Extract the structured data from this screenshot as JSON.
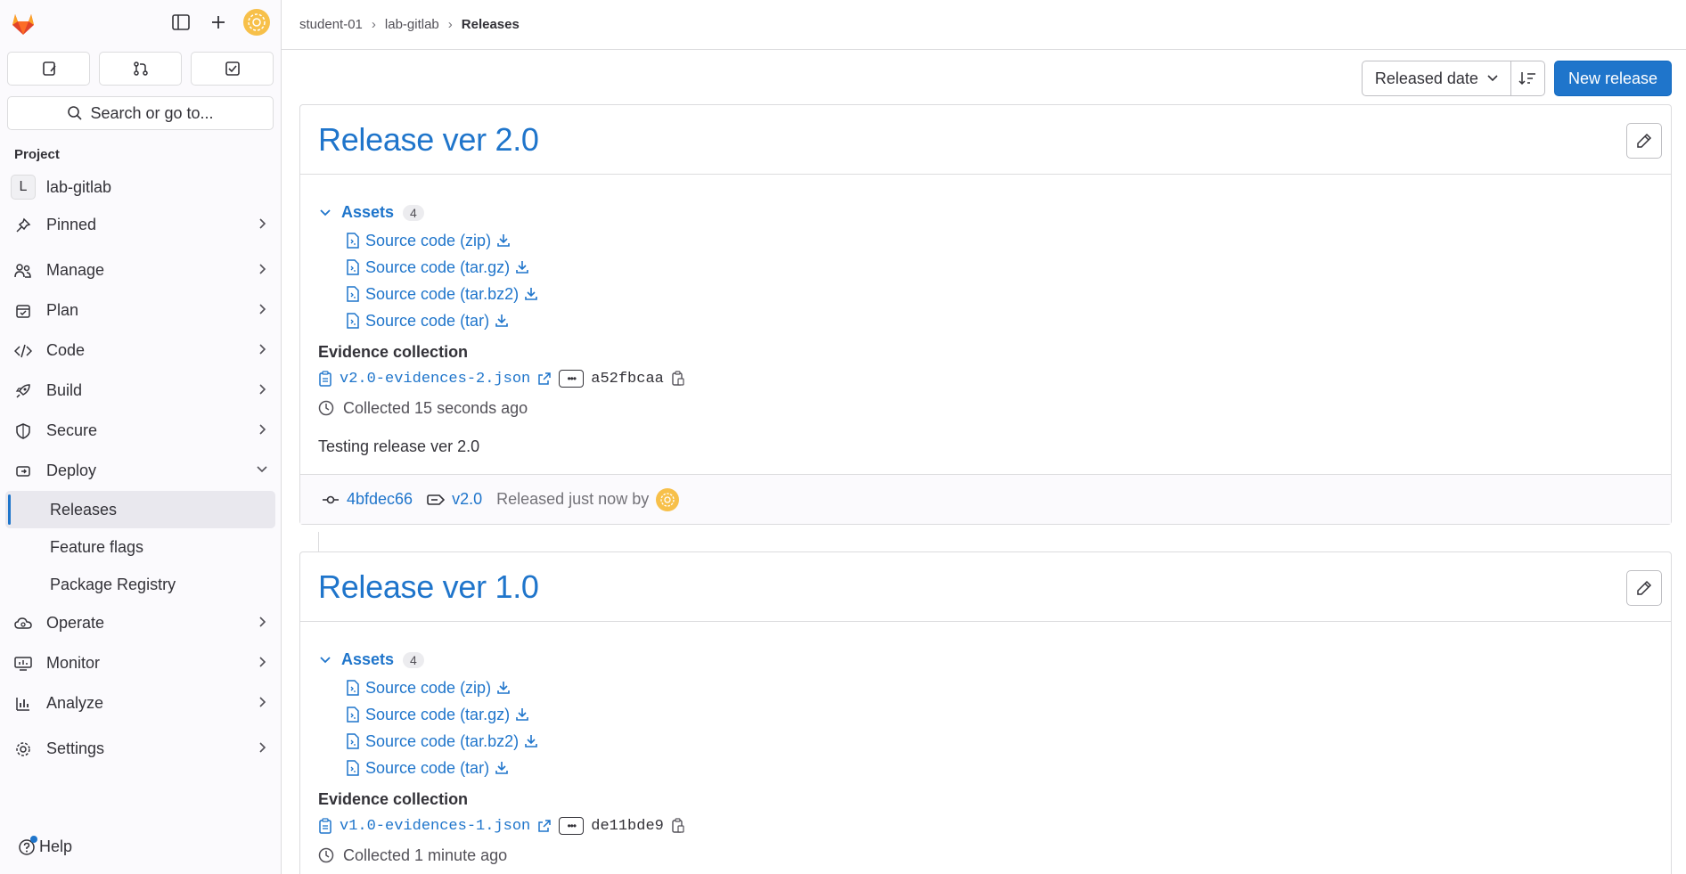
{
  "breadcrumb": {
    "items": [
      "student-01",
      "lab-gitlab"
    ],
    "current": "Releases"
  },
  "sidebar": {
    "section_title": "Project",
    "project": {
      "initial": "L",
      "name": "lab-gitlab"
    },
    "nav": [
      {
        "label": "Pinned",
        "icon": "pin-icon"
      },
      {
        "label": "Manage",
        "icon": "users-icon"
      },
      {
        "label": "Plan",
        "icon": "calendar-icon"
      },
      {
        "label": "Code",
        "icon": "code-icon"
      },
      {
        "label": "Build",
        "icon": "rocket-icon"
      },
      {
        "label": "Secure",
        "icon": "shield-icon"
      },
      {
        "label": "Deploy",
        "icon": "deploy-icon"
      }
    ],
    "deploy_sub": [
      "Releases",
      "Feature flags",
      "Package Registry"
    ],
    "nav2": [
      {
        "label": "Operate",
        "icon": "cloud-icon"
      },
      {
        "label": "Monitor",
        "icon": "monitor-icon"
      },
      {
        "label": "Analyze",
        "icon": "chart-icon"
      }
    ],
    "settings_label": "Settings",
    "search_placeholder": "Search or go to...",
    "help_label": "Help"
  },
  "toolbar": {
    "sort_label": "Released date",
    "new_release_label": "New release"
  },
  "releases": [
    {
      "title": "Release ver 2.0",
      "assets_label": "Assets",
      "assets_count": "4",
      "assets": [
        "Source code (zip)",
        "Source code (tar.gz)",
        "Source code (tar.bz2)",
        "Source code (tar)"
      ],
      "evidence_title": "Evidence collection",
      "evidence_file": "v2.0-evidences-2.json",
      "evidence_hash": "a52fbcaa",
      "collected": "Collected 15 seconds ago",
      "description": "Testing release ver 2.0",
      "commit": "4bfdec66",
      "tag": "v2.0",
      "released_text": "Released just now by"
    },
    {
      "title": "Release ver 1.0",
      "assets_label": "Assets",
      "assets_count": "4",
      "assets": [
        "Source code (zip)",
        "Source code (tar.gz)",
        "Source code (tar.bz2)",
        "Source code (tar)"
      ],
      "evidence_title": "Evidence collection",
      "evidence_file": "v1.0-evidences-1.json",
      "evidence_hash": "de11bde9",
      "collected": "Collected 1 minute ago"
    }
  ],
  "colors": {
    "accent": "#1f75cb",
    "avatar": "#f7c04a",
    "logo": "#e24329"
  }
}
